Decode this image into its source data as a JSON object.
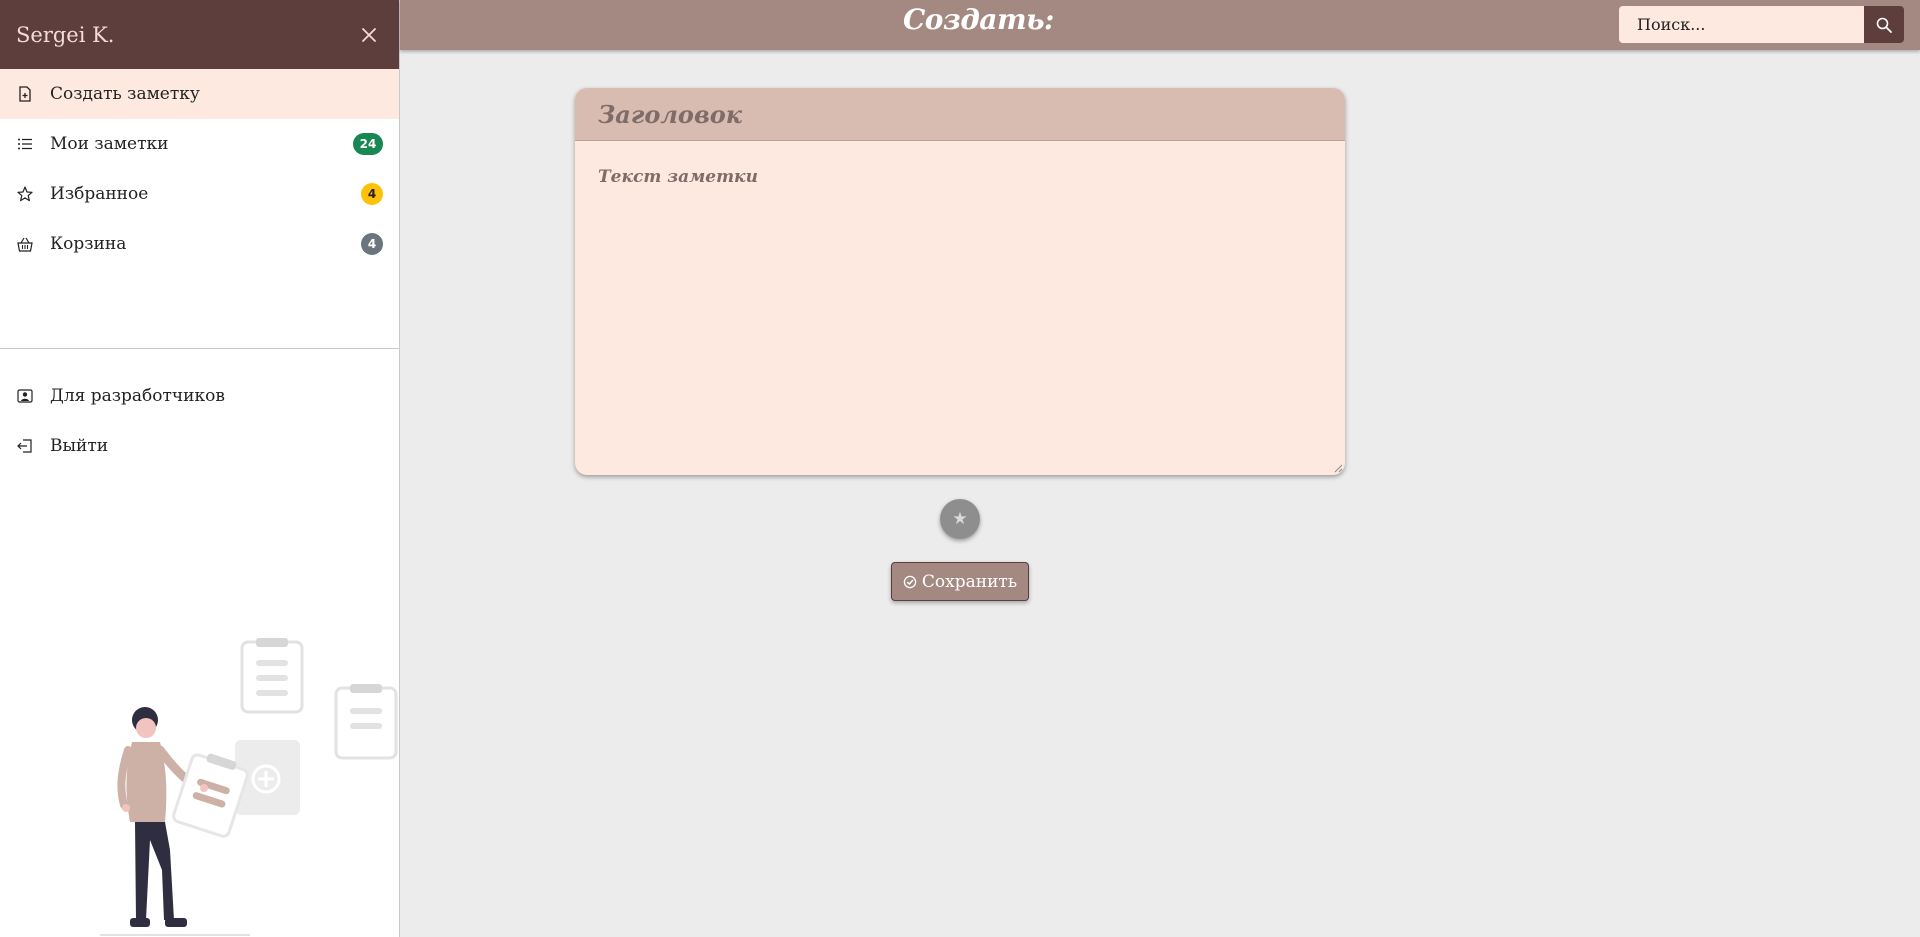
{
  "sidebar": {
    "user_name": "Sergei K.",
    "items": [
      {
        "label": "Создать заметку",
        "icon": "file-plus-icon",
        "badge": ""
      },
      {
        "label": "Мои заметки",
        "icon": "list-icon",
        "badge": "24"
      },
      {
        "label": "Избранное",
        "icon": "star-icon",
        "badge": "4"
      },
      {
        "label": "Корзина",
        "icon": "basket-icon",
        "badge": "4"
      }
    ],
    "secondary": [
      {
        "label": "Для разработчиков",
        "icon": "person-badge-icon"
      },
      {
        "label": "Выйти",
        "icon": "logout-icon"
      }
    ]
  },
  "header": {
    "title": "Создать:",
    "search_placeholder": "Поиск..."
  },
  "editor": {
    "title_placeholder": "Заголовок",
    "body_placeholder": "Текст заметки",
    "favorite_icon": "★",
    "save_label": "Сохранить"
  },
  "colors": {
    "sidebar_header": "#5e3d3d",
    "topbar": "#a48982",
    "active_item": "#fde9df",
    "note_background": "#fde9df",
    "note_title_bar": "#d8bbb1",
    "badge_green": "#198754",
    "badge_yellow": "#ffc107",
    "badge_gray": "#6c757d"
  }
}
